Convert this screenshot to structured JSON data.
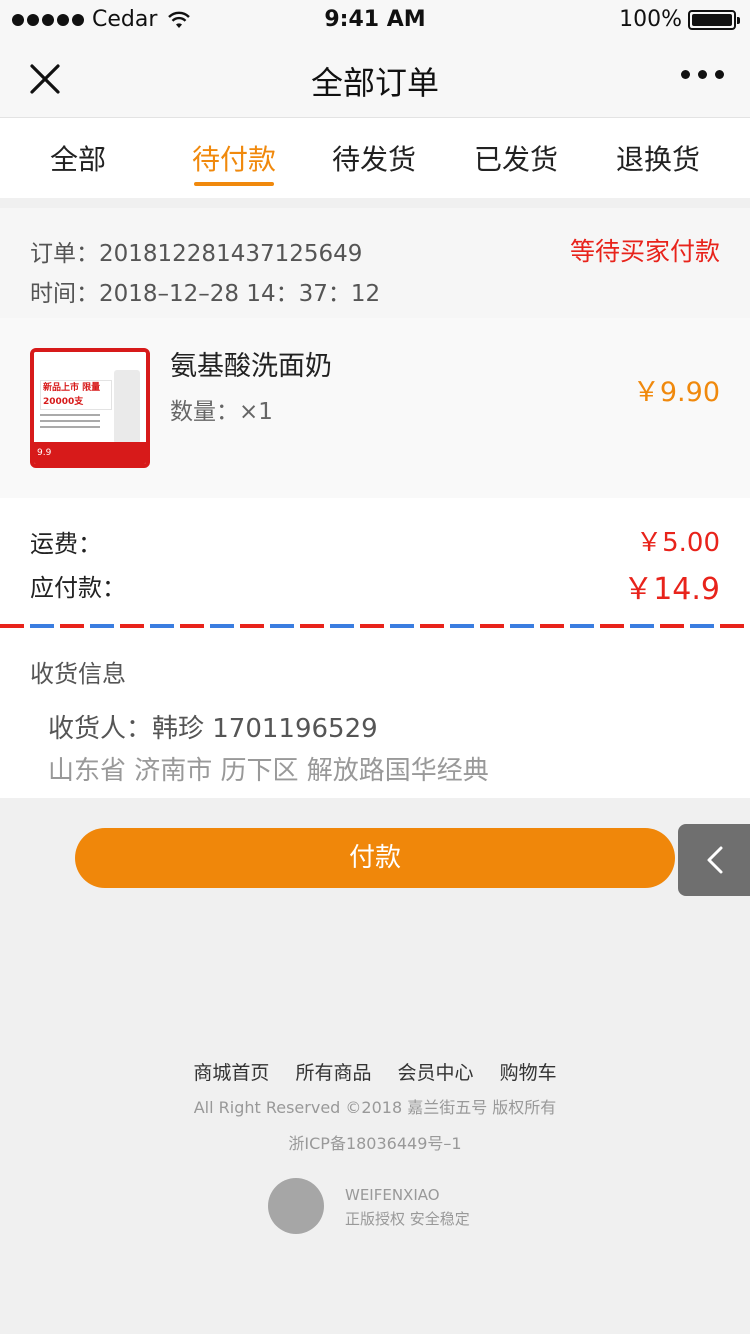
{
  "status_bar": {
    "carrier": "Cedar",
    "time": "9:41 AM",
    "battery": "100%"
  },
  "nav": {
    "title": "全部订单"
  },
  "tabs": [
    {
      "label": "全部"
    },
    {
      "label": "待付款"
    },
    {
      "label": "待发货"
    },
    {
      "label": "已发货"
    },
    {
      "label": "退换货"
    }
  ],
  "order": {
    "number": "订单：201812281437125649",
    "time": "时间：2018–12–28 14：37：12",
    "status": "等待买家付款",
    "product": {
      "name": "氨基酸洗面奶",
      "quantity": "数量：×1",
      "price": "￥9.90",
      "image_badge": "新品上市 限量20000支",
      "image_price": "9.9"
    },
    "shipping_fee_label": "运费：",
    "shipping_fee": "￥5.00",
    "payable_label": "应付款：",
    "payable": "￥14.9"
  },
  "shipping": {
    "title": "收货信息",
    "receiver": "收货人：韩珍 1701196529",
    "address": "山东省 济南市 历下区 解放路国华经典"
  },
  "actions": {
    "pay_label": "付款"
  },
  "footer": {
    "links": [
      "商城首页",
      "所有商品",
      "会员中心",
      "购物车"
    ],
    "copyright": "All Right Reserved ©2018 嘉兰街五号 版权所有",
    "icp": "浙ICP备18036449号–1",
    "brand": "WEIFENXIAO",
    "slogan": "正版授权  安全稳定"
  },
  "colors": {
    "accent": "#f0890d",
    "alert": "#e8231b",
    "pay_button": "#f0870a"
  }
}
